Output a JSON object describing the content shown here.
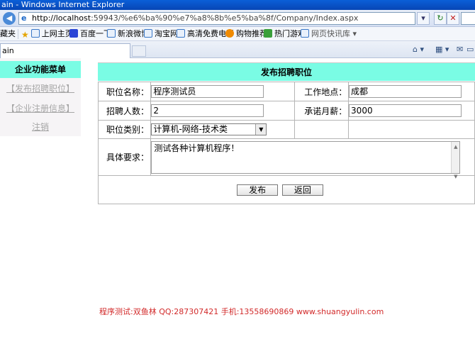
{
  "window": {
    "title": "ain - Windows Internet Explorer"
  },
  "address": {
    "host": "http://localhost",
    "path": ":59943/%e6%ba%90%e7%a8%8b%e5%ba%8f/Company/Index.aspx"
  },
  "favorites": {
    "label": "藏夹",
    "items": [
      "上网主页",
      "百度一下",
      "新浪微博",
      "淘宝网",
      "高清免费电影",
      "购物推荐",
      "热门游戏",
      "网页快讯库 ▾"
    ]
  },
  "tab": {
    "title": "ain"
  },
  "sidebar": {
    "title": "企业功能菜单",
    "links": [
      "【发布招聘职位】",
      "【企业注册信息】",
      "注销"
    ]
  },
  "form": {
    "title": "发布招聘职位",
    "job_name_label": "职位名称：",
    "job_name_value": "程序测试员",
    "location_label": "工作地点：",
    "location_value": "成都",
    "headcount_label": "招聘人数：",
    "headcount_value": "2",
    "salary_label": "承诺月薪：",
    "salary_value": "3000",
    "category_label": "职位类别：",
    "category_value": "计算机-网络-技术类",
    "requirements_label": "具体要求：",
    "requirements_value": "测试各种计算机程序！",
    "submit_label": "发布",
    "back_label": "返回"
  },
  "footer": {
    "text": "程序测试:双鱼林 QQ:287307421 手机:13558690869 www.shuangyulin.com"
  }
}
